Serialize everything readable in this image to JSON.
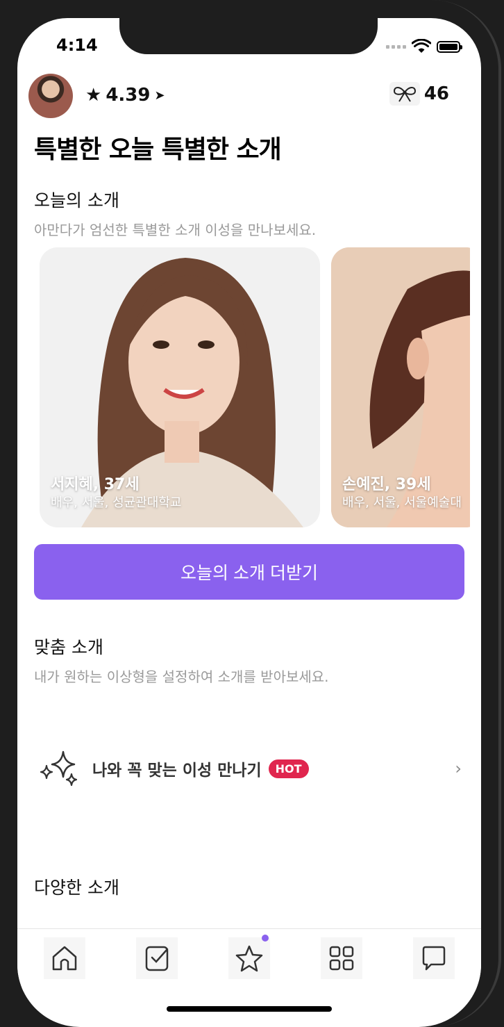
{
  "status_bar": {
    "time": "4:14"
  },
  "header": {
    "rating": "4.39",
    "hearts": "46"
  },
  "page_title": "특별한 오늘 특별한 소개",
  "today_section": {
    "title": "오늘의 소개",
    "subtitle": "아만다가 엄선한 특별한 소개 이성을 만나보세요.",
    "cards": [
      {
        "name": "서지혜, 37세",
        "info": "배우, 서울, 성균관대학교"
      },
      {
        "name": "손예진, 39세",
        "info": "배우, 서울, 서울예술대"
      }
    ],
    "more_button": "오늘의 소개 더받기"
  },
  "match_section": {
    "title": "맞춤 소개",
    "subtitle": "내가 원하는 이상형을 설정하여 소개를 받아보세요.",
    "item_label": "나와 꼭 맞는 이성 만나기",
    "badge": "HOT"
  },
  "various_section": {
    "title": "다양한 소개"
  },
  "tabs": [
    {
      "icon": "home-icon"
    },
    {
      "icon": "check-card-icon"
    },
    {
      "icon": "star-icon"
    },
    {
      "icon": "grid-icon"
    },
    {
      "icon": "chat-icon"
    }
  ],
  "colors": {
    "accent": "#8a61ee",
    "hot": "#e0264e"
  }
}
